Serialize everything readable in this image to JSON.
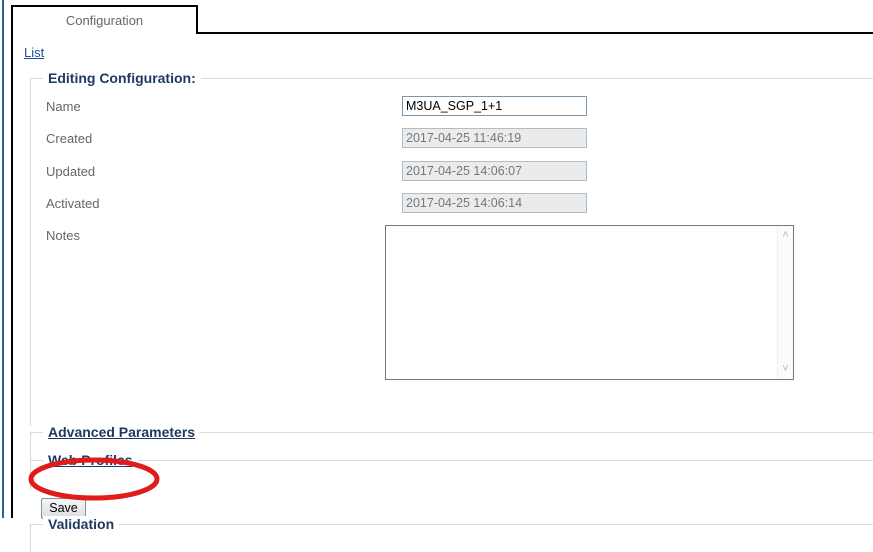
{
  "tabs": {
    "items": [
      {
        "label": "Configuration",
        "active": true
      }
    ]
  },
  "breadcrumb": {
    "list_link": "List"
  },
  "main_section": {
    "legend": "Editing Configuration:",
    "fields": [
      {
        "label": "Name",
        "value": "M3UA_SGP_1+1",
        "disabled": false
      },
      {
        "label": "Created",
        "value": "2017-04-25 11:46:19",
        "disabled": true
      },
      {
        "label": "Updated",
        "value": "2017-04-25 14:06:07",
        "disabled": true
      },
      {
        "label": "Activated",
        "value": "2017-04-25 14:06:14",
        "disabled": true
      }
    ],
    "notes": {
      "label": "Notes",
      "value": "",
      "placeholder": ""
    }
  },
  "sections": {
    "advanced_parameters": "Advanced Parameters",
    "web_profiles": "Web Profiles",
    "validation": "Validation"
  },
  "actions": {
    "save_label": "Save"
  },
  "scrollbar": {
    "up_icon": "˄",
    "down_icon": "˅"
  },
  "colors": {
    "legend_navy": "#1f3864",
    "link_blue": "#1f4e9c",
    "annotation_red": "#e11b1b",
    "tab_border": "#000000",
    "field_disabled_bg": "#ebebeb"
  }
}
